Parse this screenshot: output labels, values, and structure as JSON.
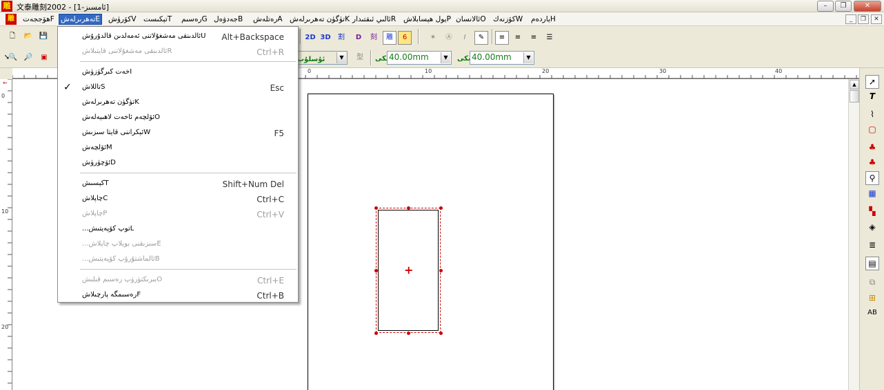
{
  "window": {
    "title": "文泰雕刻2002 - [ئامسىز-1]",
    "app_icon_glyph": "雕",
    "buttons": {
      "minimize": "–",
      "restore": "❐",
      "close": "✕"
    }
  },
  "menubar": {
    "logo_glyph": "雕",
    "items": [
      {
        "label": "ھۆججەتF"
      },
      {
        "label": "تەھرىرلەشE"
      },
      {
        "label": "كۆرۈشV"
      },
      {
        "label": "تېكىستT"
      },
      {
        "label": "رەسىمG"
      },
      {
        "label": "جەدۋەلB"
      },
      {
        "label": "رەتلەشA"
      },
      {
        "label": "تۈگۈن تەھرىرلەشK"
      },
      {
        "label": "ئالىي ئىقتىدارR"
      },
      {
        "label": "يول ھېسابلاشP"
      },
      {
        "label": "ئالانسانO"
      },
      {
        "label": "كۆزنەكW"
      },
      {
        "label": "ياردەمH"
      }
    ],
    "mdi_buttons": {
      "minimize": "_",
      "restore": "❐",
      "close": "✕"
    }
  },
  "toolbar": {
    "row1_text_buttons": [
      "2D",
      "3D",
      "割",
      "D",
      "刻",
      "雕",
      "6"
    ],
    "labels": {
      "style": "ئۇسلۇب",
      "height": "ئېگىزلىكى",
      "width": "كەڭلىكى"
    },
    "height_value": "40.00mm",
    "width_value": "40.00mm"
  },
  "ruler": {
    "h_numbers": [
      "0",
      "10",
      "20",
      "30",
      "40"
    ],
    "v_numbers": [
      "0",
      "10",
      "20"
    ]
  },
  "dropdown": {
    "items": [
      {
        "label": "ئالدىنقى مەشغۇلاتنى ئەمەلدىن قالدۇرۇشU",
        "shortcut": "Alt+Backspace",
        "disabled": false,
        "checked": false
      },
      {
        "label": "ئالدىنقى مەشغۇلاتنى قايتىلاشR",
        "shortcut": "Ctrl+R",
        "disabled": true,
        "checked": false
      },
      {
        "label": "خەت كىرگۈزۈشI",
        "shortcut": "",
        "disabled": false,
        "checked": false
      },
      {
        "label": "تاللاشS",
        "shortcut": "Esc",
        "disabled": false,
        "checked": true
      },
      {
        "label": "تۈگۈن تەھرىرلەشK",
        "shortcut": "",
        "disabled": false,
        "checked": false
      },
      {
        "label": "ئۆلچەم ئاخەت لاھىيەلەشO",
        "shortcut": "",
        "disabled": false,
        "checked": false
      },
      {
        "label": "ئېكراننى قايتا سىزىشW",
        "shortcut": "F5",
        "disabled": false,
        "checked": false
      },
      {
        "label": "ئۆلچەشM",
        "shortcut": "",
        "disabled": false,
        "checked": false
      },
      {
        "label": "ئۆچۈرۈشD",
        "shortcut": "",
        "disabled": false,
        "checked": false
      },
      {
        "label": "كېسىشT",
        "shortcut": "Shift+Num Del",
        "disabled": false,
        "checked": false
      },
      {
        "label": "چاپلاشC",
        "shortcut": "Ctrl+C",
        "disabled": false,
        "checked": false
      },
      {
        "label": "چاپلاشP",
        "shortcut": "Ctrl+V",
        "disabled": true,
        "checked": false
      },
      {
        "label": "...توپ كۆپەيتىشL",
        "shortcut": "",
        "disabled": false,
        "checked": false
      },
      {
        "label": "...سىزىقنى بويلاپ چاپلاشE",
        "shortcut": "",
        "disabled": true,
        "checked": false
      },
      {
        "label": "...ئالماشتۇرۇپ كۆپەيتىشB",
        "shortcut": "",
        "disabled": true,
        "checked": false
      },
      {
        "label": "بىرىكتۈرۈپ رەسىم قىلىشO",
        "shortcut": "Ctrl+E",
        "disabled": true,
        "checked": false
      },
      {
        "label": "رەسىمگە پارچىلاشF",
        "shortcut": "Ctrl+B",
        "disabled": false,
        "checked": false
      }
    ]
  }
}
